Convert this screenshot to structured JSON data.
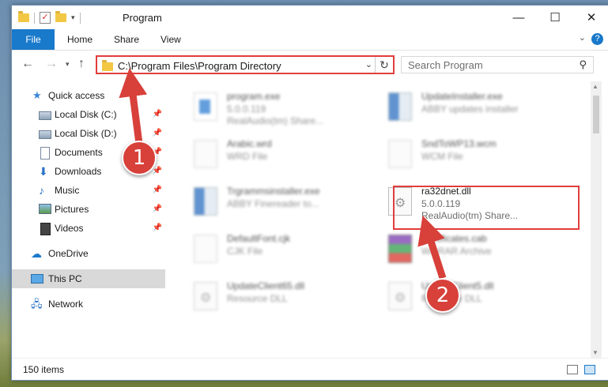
{
  "window": {
    "title": "Program",
    "controls": [
      "minimize",
      "maximize",
      "close"
    ]
  },
  "ribbon": {
    "tabs": [
      "File",
      "Home",
      "Share",
      "View"
    ],
    "help": "?"
  },
  "address_bar": {
    "path": "C:\\Program Files\\Program Directory"
  },
  "search": {
    "placeholder": "Search Program"
  },
  "sidebar": {
    "items": [
      {
        "label": "Quick access",
        "icon": "star-icon"
      },
      {
        "label": "Local Disk (C:)",
        "icon": "disk-icon"
      },
      {
        "label": "Local Disk (D:)",
        "icon": "disk-icon"
      },
      {
        "label": "Documents",
        "icon": "documents-icon"
      },
      {
        "label": "Downloads",
        "icon": "download-icon"
      },
      {
        "label": "Music",
        "icon": "music-icon"
      },
      {
        "label": "Pictures",
        "icon": "pictures-icon"
      },
      {
        "label": "Videos",
        "icon": "videos-icon"
      },
      {
        "label": "OneDrive",
        "icon": "cloud-icon"
      },
      {
        "label": "This PC",
        "icon": "computer-icon"
      },
      {
        "label": "Network",
        "icon": "network-icon"
      }
    ]
  },
  "files": [
    {
      "name": "program.exe",
      "line1": "5.0.0.119",
      "line2": "RealAudio(tm) Share...",
      "icon": "app-icon"
    },
    {
      "name": "UpdateInstaller.exe",
      "line1": "ABBY updates installer",
      "line2": "",
      "icon": "installer-icon"
    },
    {
      "name": "Arabic.wrd",
      "line1": "WRD File",
      "line2": "",
      "icon": "page-icon"
    },
    {
      "name": "SndToWP13.wcm",
      "line1": "WCM File",
      "line2": "",
      "icon": "page-icon"
    },
    {
      "name": "Trgrammsinstaller.exe",
      "line1": "ABBY Finereader to...",
      "line2": "",
      "icon": "installer-icon"
    },
    {
      "name": "ra32dnet.dll",
      "line1": "5.0.0.119",
      "line2": "RealAudio(tm) Share...",
      "icon": "dll-icon"
    },
    {
      "name": "DefaultFont.cjk",
      "line1": "CJK File",
      "line2": "",
      "icon": "page-icon"
    },
    {
      "name": "Certificates.cab",
      "line1": "WinRAR Archive",
      "line2": "",
      "icon": "archive-icon"
    },
    {
      "name": "UpdateClient65.dll",
      "line1": "Resource DLL",
      "line2": "",
      "icon": "dll-icon"
    },
    {
      "name": "UpdateClient5.dll",
      "line1": "Resource DLL",
      "line2": "",
      "icon": "dll-icon"
    }
  ],
  "status": {
    "items_count": "150 items"
  },
  "annotations": {
    "step1": "1",
    "step2": "2",
    "accent": "#d8403a"
  }
}
